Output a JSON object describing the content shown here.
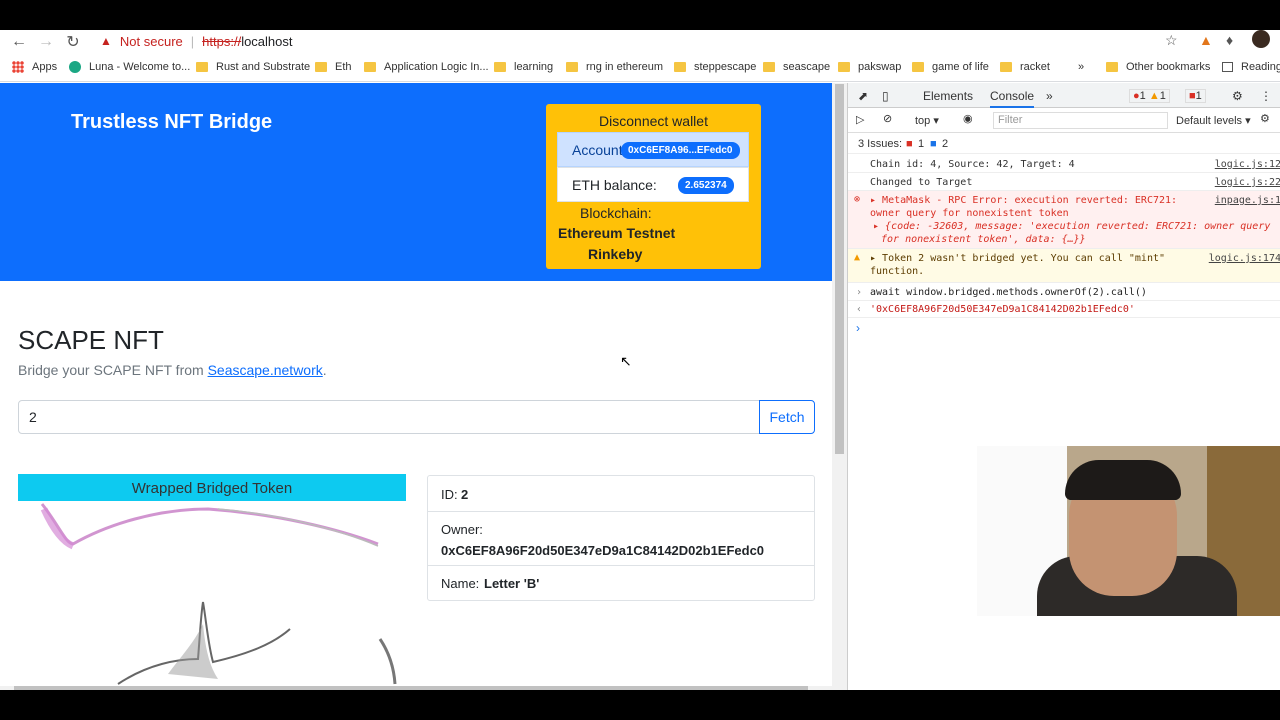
{
  "browser": {
    "not_secure": "Not secure",
    "url_scheme": "https://",
    "url_host": "localhost"
  },
  "bookmarks": [
    {
      "label": "Apps"
    },
    {
      "label": "Luna - Welcome to..."
    },
    {
      "label": "Rust and Substrate"
    },
    {
      "label": "Eth"
    },
    {
      "label": "Application Logic In..."
    },
    {
      "label": "learning"
    },
    {
      "label": "rng in ethereum"
    },
    {
      "label": "steppescape"
    },
    {
      "label": "seascape"
    },
    {
      "label": "pakswap"
    },
    {
      "label": "game of life"
    },
    {
      "label": "racket"
    },
    {
      "label": "»"
    },
    {
      "label": "Other bookmarks"
    },
    {
      "label": "Reading"
    }
  ],
  "header": {
    "brand": "Trustless NFT Bridge"
  },
  "wallet": {
    "disconnect": "Disconnect wallet",
    "account_label": "Account",
    "account_value": "0xC6EF8A96...EFedc0",
    "balance_label": "ETH balance:",
    "balance_value": "2.652374",
    "blockchain_label": "Blockchain:",
    "blockchain_name": "Ethereum Testnet",
    "blockchain_network": "Rinkeby"
  },
  "main": {
    "title": "SCAPE NFT",
    "lead_text": "Bridge your SCAPE NFT from ",
    "lead_link": "Seascape.network",
    "lead_end": ".",
    "token_value": "2",
    "fetch_label": "Fetch"
  },
  "card": {
    "header": "Wrapped Bridged Token",
    "id_label": "ID:",
    "id_value": "2",
    "owner_label": "Owner:",
    "owner_value": "0xC6EF8A96F20d50E347eD9a1C84142D02b1EFedc0",
    "name_label": "Name:",
    "name_value": "Letter 'B'"
  },
  "devtools": {
    "tabs": [
      "Elements",
      "Console"
    ],
    "error_count": "1",
    "warn_count": "1",
    "issue_count": "1",
    "context": "top",
    "filter_placeholder": "Filter",
    "levels": "Default levels",
    "issues_label": "3 Issues:",
    "issues_err": "1",
    "issues_info": "2",
    "logs": [
      {
        "msg": "Chain id: 4, Source: 42, Target: 4",
        "src": "logic.js:12"
      },
      {
        "msg": "Changed to Target",
        "src": "logic.js:22"
      },
      {
        "msg": "MetaMask - RPC Error: execution reverted: ERC721:",
        "msg2": "owner query for nonexistent token",
        "src": "inpage.js:1"
      },
      {
        "msg": "{code: -32603, message: 'execution reverted: ERC721: owner query",
        "msg2": "for nonexistent token', data: {…}}"
      },
      {
        "msg": "Token 2 wasn't bridged yet. You can call \"mint\"",
        "msg2": "function.",
        "src": "logic.js:174"
      },
      {
        "msg": "await window.bridged.methods.ownerOf(2).call()"
      },
      {
        "msg": "'0xC6EF8A96F20d50E347eD9a1C84142D02b1EFedc0'"
      }
    ]
  }
}
